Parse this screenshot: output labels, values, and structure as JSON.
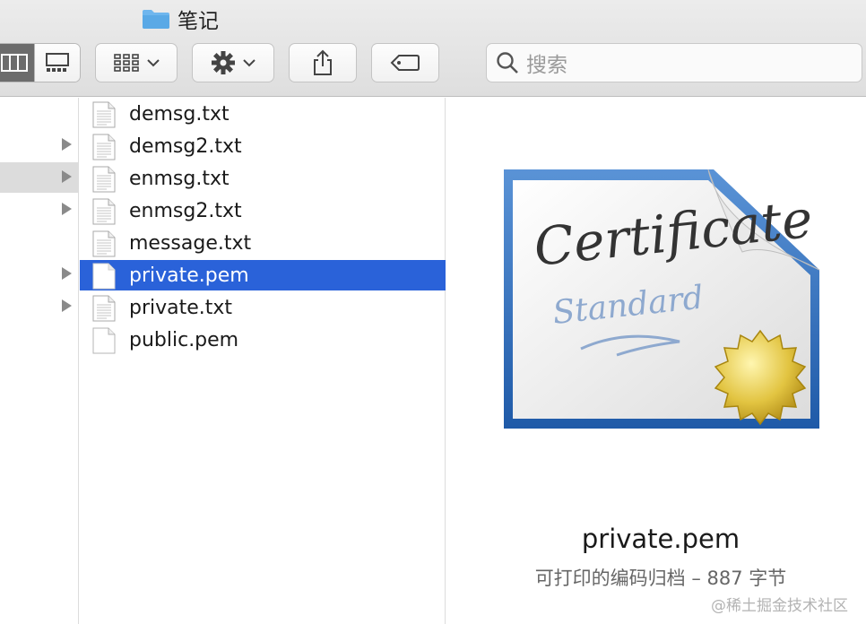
{
  "window": {
    "title": "笔记",
    "title_icon": "folder-icon"
  },
  "toolbar": {
    "view_column_icon": "columns-view-icon",
    "view_gallery_icon": "gallery-view-icon",
    "group_icon": "grid-group-icon",
    "action_icon": "gear-icon",
    "share_icon": "share-icon",
    "tag_icon": "tag-icon",
    "search_placeholder": "搜索"
  },
  "files": [
    {
      "name": "demsg.txt",
      "icon": "text-file-icon",
      "has_arrow": false
    },
    {
      "name": "demsg2.txt",
      "icon": "text-file-icon",
      "has_arrow": true
    },
    {
      "name": "enmsg.txt",
      "icon": "text-file-icon",
      "has_arrow": true
    },
    {
      "name": "enmsg2.txt",
      "icon": "text-file-icon",
      "has_arrow": true
    },
    {
      "name": "message.txt",
      "icon": "text-file-icon",
      "has_arrow": false
    },
    {
      "name": "private.pem",
      "icon": "blank-file-icon",
      "has_arrow": true,
      "selected": true
    },
    {
      "name": "private.txt",
      "icon": "text-file-icon",
      "has_arrow": true
    },
    {
      "name": "public.pem",
      "icon": "blank-file-icon",
      "has_arrow": false
    }
  ],
  "preview": {
    "icon": "certificate-icon",
    "filename": "private.pem",
    "info": "可打印的编码归档 – 887 字节"
  },
  "watermark": "@稀土掘金技术社区",
  "colors": {
    "selection": "#2a62d9",
    "folder": "#5aa9e6",
    "cert_frame": "#2d6cb8",
    "seal": "#e0c84a"
  }
}
